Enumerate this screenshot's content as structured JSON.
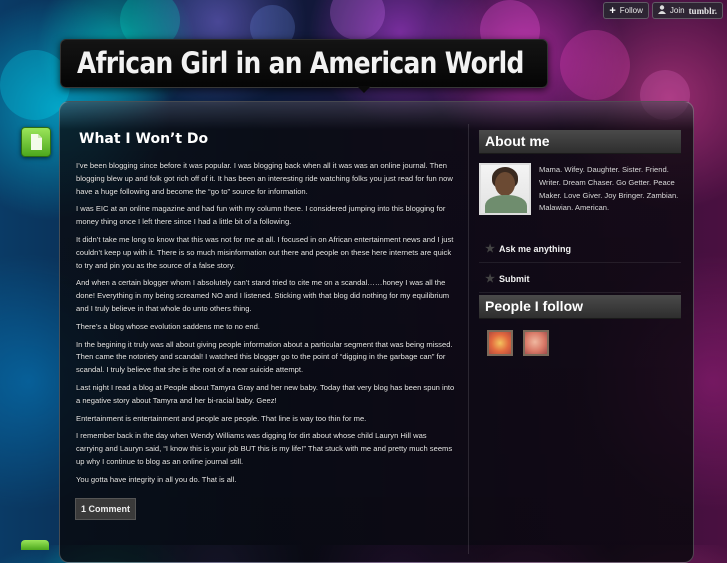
{
  "topbar": {
    "follow_label": "Follow",
    "join_label": "Join",
    "brand_label": "tumblr."
  },
  "blog": {
    "title": "African Girl in an American World"
  },
  "post": {
    "title": "What I Won’t Do",
    "paragraphs": [
      "I’ve been blogging since before it was popular.  I was blogging back when all it was was an online journal.  Then blogging blew up and folk got rich off of it.  It has been an interesting ride watching folks you just read for fun now have a huge following and become the “go to” source for information.",
      "I was EIC at an online magazine and had fun with my column there. I considered jumping into this blogging for money thing once I left there since I had a little bit of a following.",
      "It didn’t take me long to know that this was not for me at all.  I focused in on African entertainment news and I just couldn’t keep up with it.  There is so much misinformation out there and people on these here internets are quick to try and pin you as the source of a false story.",
      "And when a certain blogger whom I absolutely can’t stand tried to cite me on a scandal……honey I was all the done!  Everything in my being screamed NO and I listened.  Sticking with that blog did nothing for my equilibrium and I truly believe in that whole do unto others thing.",
      "There’s a blog whose evolution saddens me to no end.",
      "In the begining it truly was all about giving people information about a particular segment that was being missed.  Then came the notoriety and scandal!  I watched this blogger go to the point of “digging in the garbage can” for scandal.  I truly believe that she is the root of a near suicide attempt.",
      "Last night I read a blog at People about Tamyra Gray and her new baby. Today that very blog has been spun into a negative story about Tamyra and her bi-racial baby. Geez!",
      "Entertainment is entertainment and people are people.  That line is way too thin for me.",
      "I remember back in the day when Wendy Williams was digging for dirt about whose child Lauryn Hill was carrying and Lauryn said, “I know this is your job BUT this is my life!”  That stuck with me and pretty much seems up why I continue to blog as an online journal still.",
      "You gotta have integrity in all you do.  That is all."
    ],
    "comment_label": "1 Comment"
  },
  "sidebar": {
    "about_heading": "About me",
    "about_text": "Mama. Wifey. Daughter. Sister. Friend. Writer. Dream Chaser. Go Getter. Peace Maker. Love Giver. Joy Bringer. Zambian. Malawian. American.",
    "links": [
      {
        "label": "Ask me anything"
      },
      {
        "label": "Submit"
      }
    ],
    "people_heading": "People I follow"
  },
  "colors": {
    "accent_green": "#4da81d",
    "panel_bg": "#0a0a0e",
    "heading_bar": "#3a3a3a"
  },
  "icons": {
    "page_icon": "page-document-icon",
    "follow_icon": "plus-icon",
    "join_icon": "user-icon",
    "link_icon": "star-icon"
  }
}
